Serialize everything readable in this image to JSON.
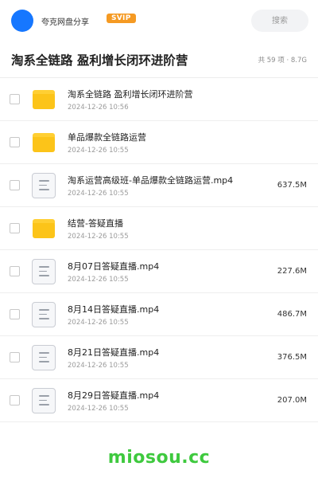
{
  "header": {
    "user_name": "夸克网盘分享",
    "badge": "SVIP",
    "search_placeholder": "搜索",
    "avatar_color": "#1677ff"
  },
  "folder": {
    "title": "淘系全链路 盈利增长闭环进阶营",
    "summary": "共 59 项 · 8.7G"
  },
  "files": [
    {
      "type": "folder",
      "icon": "folder-icon",
      "name": "淘系全链路 盈利增长闭环进阶营",
      "date": "2024-12-26 10:56",
      "size": ""
    },
    {
      "type": "folder",
      "icon": "folder-icon",
      "name": "单品爆款全链路运营",
      "date": "2024-12-26 10:55",
      "size": ""
    },
    {
      "type": "file",
      "icon": "document-icon",
      "name": "淘系运营高级班-单品爆款全链路运营.mp4",
      "date": "2024-12-26 10:55",
      "size": "637.5M"
    },
    {
      "type": "folder",
      "icon": "folder-icon",
      "name": "结营-答疑直播",
      "date": "2024-12-26 10:55",
      "size": ""
    },
    {
      "type": "file",
      "icon": "document-icon",
      "name": "8月07日答疑直播.mp4",
      "date": "2024-12-26 10:55",
      "size": "227.6M"
    },
    {
      "type": "file",
      "icon": "document-icon",
      "name": "8月14日答疑直播.mp4",
      "date": "2024-12-26 10:55",
      "size": "486.7M"
    },
    {
      "type": "file",
      "icon": "document-icon",
      "name": "8月21日答疑直播.mp4",
      "date": "2024-12-26 10:55",
      "size": "376.5M"
    },
    {
      "type": "file",
      "icon": "document-icon",
      "name": "8月29日答疑直播.mp4",
      "date": "2024-12-26 10:55",
      "size": "207.0M"
    }
  ],
  "watermark": "miosou.cc",
  "colors": {
    "folder": "#fcc419",
    "svip": "#f59a23",
    "watermark": "#3ec93e"
  }
}
